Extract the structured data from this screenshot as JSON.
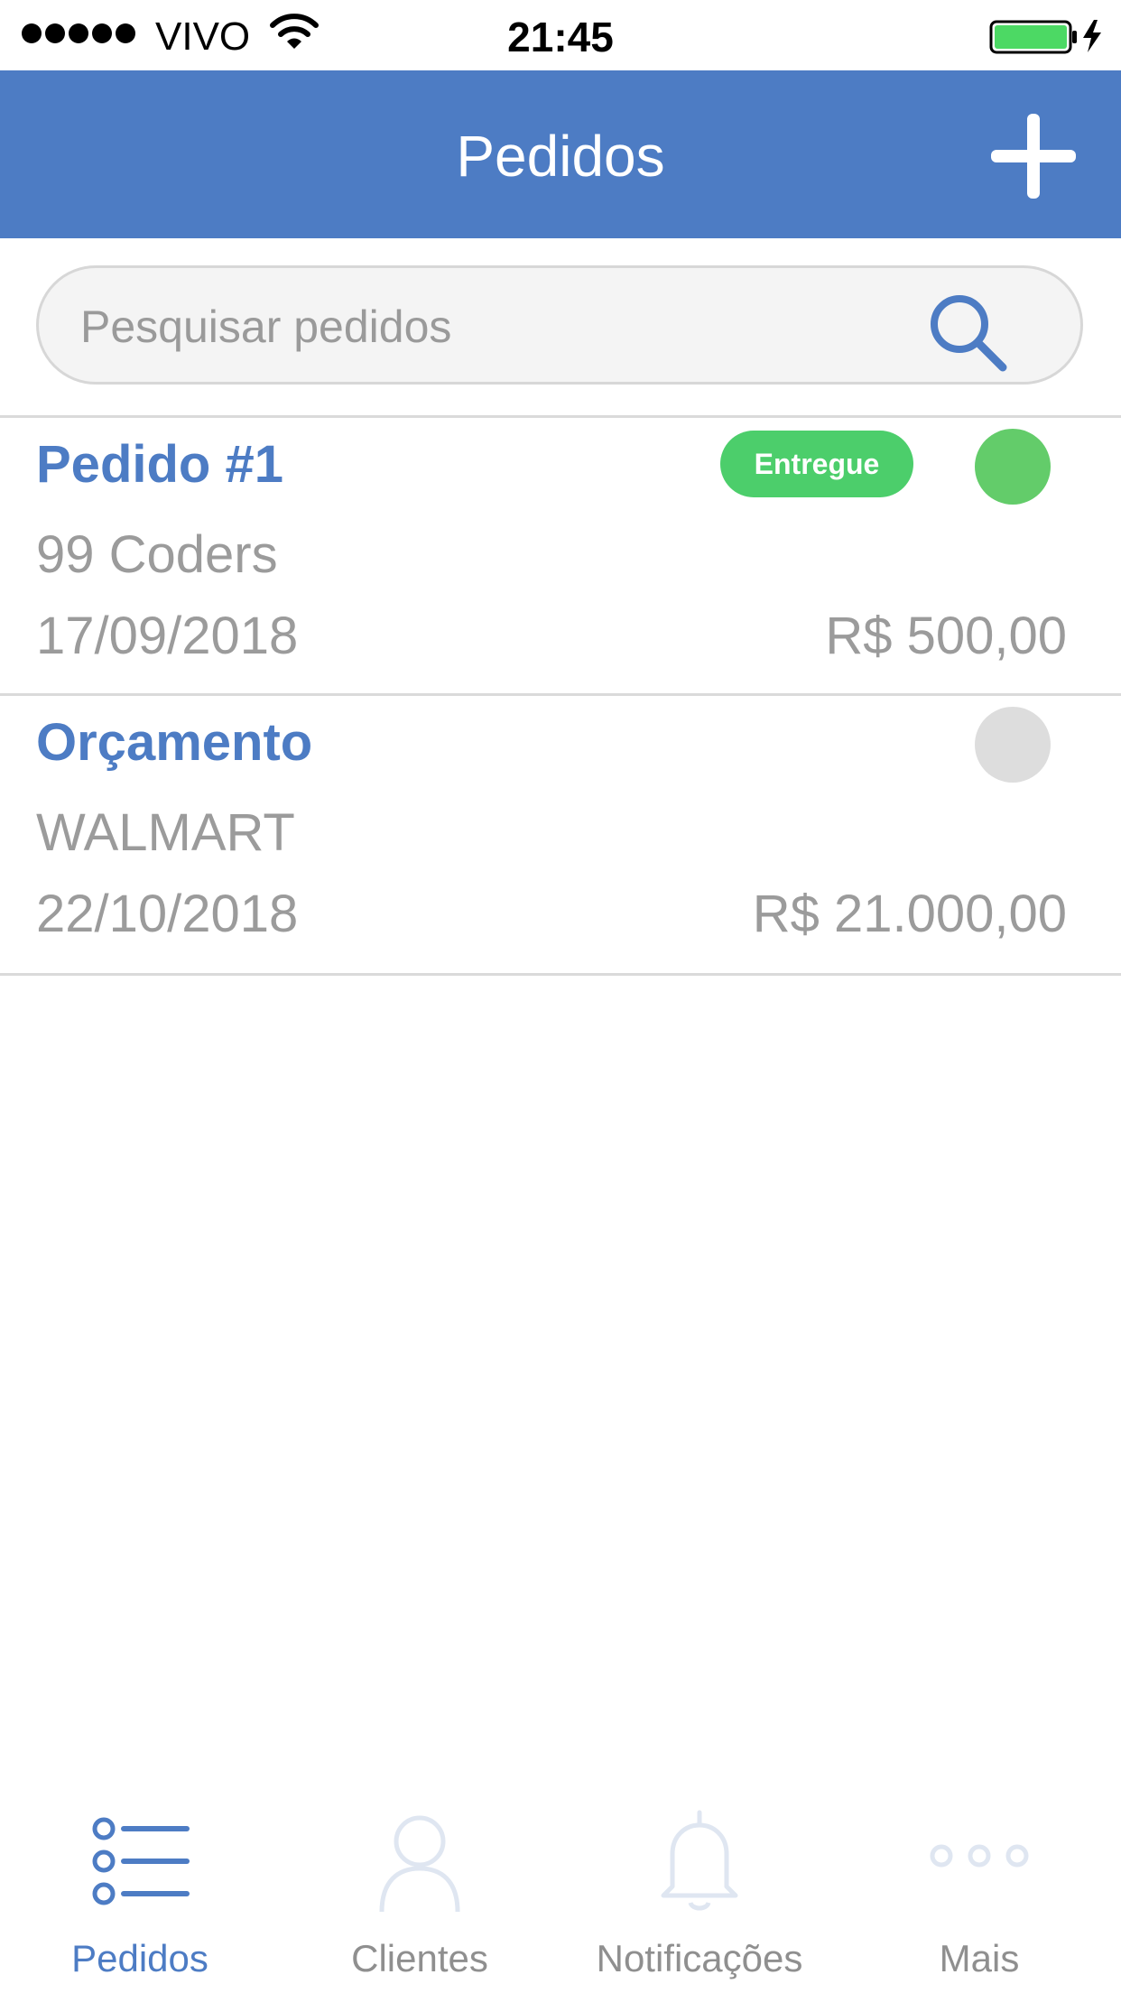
{
  "status_bar": {
    "carrier": "VIVO",
    "time": "21:45"
  },
  "navbar": {
    "title": "Pedidos",
    "add_icon": "plus-icon"
  },
  "search": {
    "placeholder": "Pesquisar pedidos",
    "value": "",
    "icon": "search-icon"
  },
  "orders": [
    {
      "title": "Pedido #1",
      "client": "99 Coders",
      "date": "17/09/2018",
      "value": "R$ 500,00",
      "badge": "Entregue",
      "status_color": "#63cc6a"
    },
    {
      "title": "Orçamento",
      "client": "WALMART",
      "date": "22/10/2018",
      "value": "R$ 21.000,00",
      "badge": "",
      "status_color": "#dddddd"
    }
  ],
  "tabs": [
    {
      "label": "Pedidos",
      "icon": "list-icon",
      "active": true
    },
    {
      "label": "Clientes",
      "icon": "user-icon",
      "active": false
    },
    {
      "label": "Notificações",
      "icon": "bell-icon",
      "active": false
    },
    {
      "label": "Mais",
      "icon": "more-icon",
      "active": false
    }
  ],
  "colors": {
    "accent": "#4d7cc4",
    "badge_green": "#4cce6b",
    "text_gray": "#9b9b9b"
  }
}
